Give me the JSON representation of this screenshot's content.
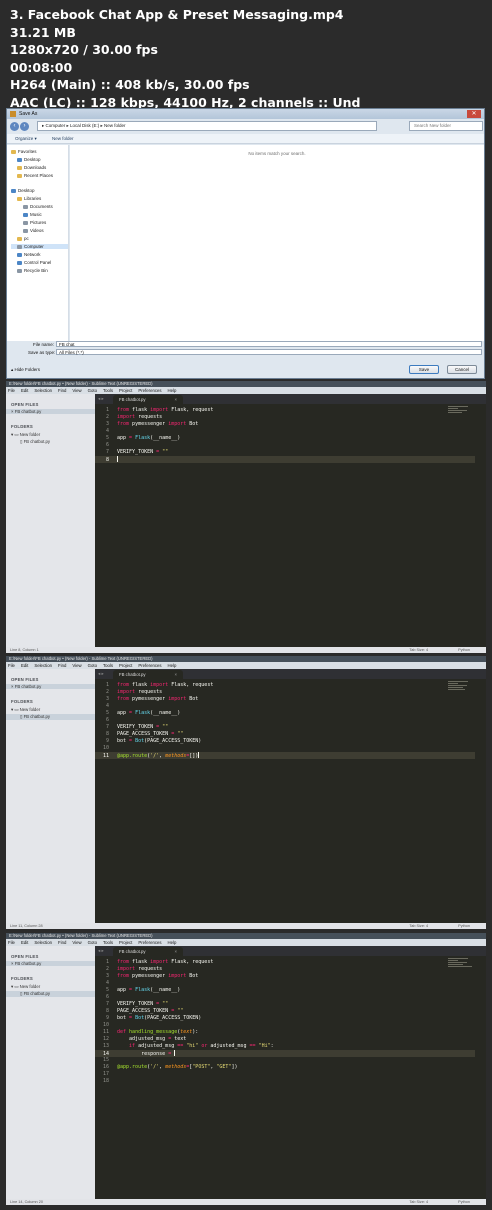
{
  "header": {
    "title": "3. Facebook Chat App & Preset Messaging.mp4",
    "size": "31.21 MB",
    "resolution": "1280x720 / 30.00 fps",
    "duration": "00:08:00",
    "video": "H264 (Main) :: 408 kb/s, 30.00 fps",
    "audio": "AAC (LC) :: 128 kbps, 44100 Hz, 2 channels :: Und"
  },
  "save_dialog": {
    "title": "Save As",
    "address_path": "▸ Computer ▸ Local Disk (E:) ▸ New folder",
    "search_placeholder": "Search New folder",
    "organize": "Organize ▾",
    "new_folder": "New folder",
    "nav": {
      "favorites": "Favorites",
      "desktop": "Desktop",
      "downloads": "Downloads",
      "recent": "Recent Places",
      "desktop2": "Desktop",
      "libraries": "Libraries",
      "documents": "Documents",
      "music": "Music",
      "pictures": "Pictures",
      "videos": "Videos",
      "pc": "pc",
      "computer": "Computer",
      "network": "Network",
      "control_panel": "Control Panel",
      "recycle_bin": "Recycle Bin"
    },
    "empty_message": "No items match your search.",
    "file_name_label": "File name:",
    "file_name_value": "FB chat",
    "save_type_label": "Save as type:",
    "save_type_value": "All Files (*.*)",
    "hide_folders": "Hide Folders",
    "save_btn": "Save",
    "cancel_btn": "Cancel"
  },
  "sublime_common": {
    "menu": [
      "File",
      "Edit",
      "Selection",
      "Find",
      "View",
      "Goto",
      "Tools",
      "Project",
      "Preferences",
      "Help"
    ],
    "open_files": "OPEN FILES",
    "folders": "FOLDERS",
    "open_file": "FB chatbot.py",
    "folder": "New folder",
    "folder_file": "FB chatbot.py",
    "tab": "FB chatbot.py",
    "tab_close": "×",
    "tab_nav": "◂ ▸",
    "tab_size": "Tab Size: 4",
    "syntax": "Python"
  },
  "sublime1": {
    "title": "E:\\New folder\\FB chatbot.py • (New folder) - Sublime Text (UNREGISTERED)",
    "status": "Line 8, Column 1",
    "lines": [
      {
        "n": "1",
        "html": "<span class='k'>from</span> flask <span class='k'>import</span> Flask, request"
      },
      {
        "n": "2",
        "html": "<span class='k'>import</span> requests"
      },
      {
        "n": "3",
        "html": "<span class='k'>from</span> pymessenger <span class='k'>import</span> Bot"
      },
      {
        "n": "4",
        "html": ""
      },
      {
        "n": "5",
        "html": "app <span class='k'>=</span> <span class='f'>Flask</span>(__name__)"
      },
      {
        "n": "6",
        "html": ""
      },
      {
        "n": "7",
        "html": "VERIFY_TOKEN <span class='k'>=</span> <span class='s'>\"\"</span>"
      },
      {
        "n": "8",
        "html": ""
      }
    ]
  },
  "sublime2": {
    "title": "E:\\New folder\\FB chatbot.py • (New folder) - Sublime Text (UNREGISTERED)",
    "status": "Line 11, Column 28",
    "lines": [
      {
        "n": "1",
        "html": "<span class='k'>from</span> flask <span class='k'>import</span> Flask, request"
      },
      {
        "n": "2",
        "html": "<span class='k'>import</span> requests"
      },
      {
        "n": "3",
        "html": "<span class='k'>from</span> pymessenger <span class='k'>import</span> Bot"
      },
      {
        "n": "4",
        "html": ""
      },
      {
        "n": "5",
        "html": "app <span class='k'>=</span> <span class='f'>Flask</span>(__name__)"
      },
      {
        "n": "6",
        "html": ""
      },
      {
        "n": "7",
        "html": "VERIFY_TOKEN <span class='k'>=</span> <span class='s'>\"\"</span>"
      },
      {
        "n": "8",
        "html": "PAGE_ACCESS_TOKEN <span class='k'>=</span> <span class='s'>\"\"</span>"
      },
      {
        "n": "9",
        "html": "bot <span class='k'>=</span> <span class='f'>Bot</span>(PAGE_ACCESS_TOKEN)"
      },
      {
        "n": "10",
        "html": ""
      },
      {
        "n": "11",
        "html": "<span class='d'>@app.route</span>(<span class='s'>'/'</span>, <span class='a'>methods</span><span class='k'>=</span>[])"
      }
    ]
  },
  "sublime3": {
    "title": "E:\\New folder\\FB chatbot.py • (New folder) - Sublime Text (UNREGISTERED)",
    "status": "Line 14, Column 20",
    "lines": [
      {
        "n": "1",
        "html": "<span class='k'>from</span> flask <span class='k'>import</span> Flask, request"
      },
      {
        "n": "2",
        "html": "<span class='k'>import</span> requests"
      },
      {
        "n": "3",
        "html": "<span class='k'>from</span> pymessenger <span class='k'>import</span> Bot"
      },
      {
        "n": "4",
        "html": ""
      },
      {
        "n": "5",
        "html": "app <span class='k'>=</span> <span class='f'>Flask</span>(__name__)"
      },
      {
        "n": "6",
        "html": ""
      },
      {
        "n": "7",
        "html": "VERIFY_TOKEN <span class='k'>=</span> <span class='s'>\"\"</span>"
      },
      {
        "n": "8",
        "html": "PAGE_ACCESS_TOKEN <span class='k'>=</span> <span class='s'>\"\"</span>"
      },
      {
        "n": "9",
        "html": "bot <span class='k'>=</span> <span class='f'>Bot</span>(PAGE_ACCESS_TOKEN)"
      },
      {
        "n": "10",
        "html": ""
      },
      {
        "n": "11",
        "html": "<span class='k'>def</span> <span class='d'>handling_message</span>(<span class='a'>text</span>):"
      },
      {
        "n": "12",
        "html": "    adjusted_msg <span class='k'>=</span> text"
      },
      {
        "n": "13",
        "html": "    <span class='k'>if</span> adjusted_msg <span class='k'>==</span> <span class='s'>\"hi\"</span> <span class='k'>or</span> adjusted_msg <span class='k'>==</span> <span class='s'>\"Hi\"</span>:"
      },
      {
        "n": "14",
        "html": "        response <span class='k'>=</span> "
      },
      {
        "n": "15",
        "html": ""
      },
      {
        "n": "16",
        "html": "<span class='d'>@app.route</span>(<span class='s'>'/'</span>, <span class='a'>methods</span><span class='k'>=</span>[<span class='s'>\"POST\"</span>, <span class='s'>\"GET\"</span>])"
      },
      {
        "n": "17",
        "html": ""
      },
      {
        "n": "18",
        "html": ""
      }
    ]
  }
}
